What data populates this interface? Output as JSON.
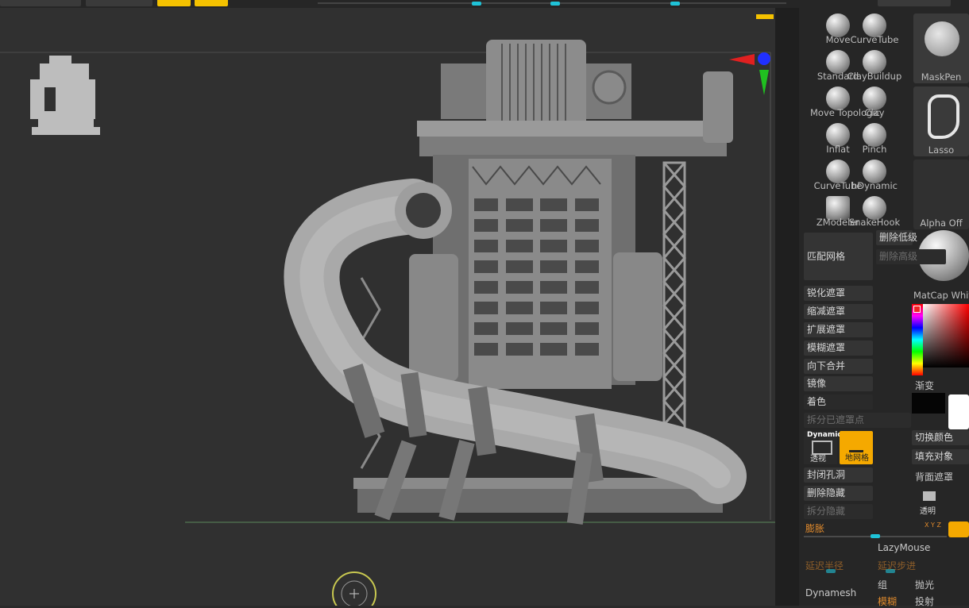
{
  "brushes": [
    {
      "label": "Move"
    },
    {
      "label": "CurveTube"
    },
    {
      "label": "Standard"
    },
    {
      "label": "ClayBuildup"
    },
    {
      "label": "Move Topologic"
    },
    {
      "label": "Clay"
    },
    {
      "label": "Inflat"
    },
    {
      "label": "Pinch"
    },
    {
      "label": "CurveTube"
    },
    {
      "label": "hDynamic"
    },
    {
      "label": "ZModeler"
    },
    {
      "label": "SnakeHook"
    }
  ],
  "thumbs": {
    "maskpen": "MaskPen",
    "lasso": "Lasso",
    "alpha": "Alpha Off",
    "matcap": "MatCap White"
  },
  "tools": {
    "match_mesh": "匹配网格",
    "delete_lower": "删除低级",
    "delete_higher": "删除高级",
    "sharpen_mask": "锐化遮罩",
    "shrink_mask": "缩减遮罩",
    "grow_mask": "扩展遮罩",
    "blur_mask": "模糊遮罩",
    "merge_down": "向下合并",
    "mirror": "镜像",
    "colorize": "着色",
    "split_masked": "拆分已遮罩点",
    "gradient": "渐变",
    "switch_color": "切换颜色",
    "fill_object": "填充对象",
    "backface_mask": "背面遮罩",
    "dynamic_label": "Dynamic",
    "perspective": "透视",
    "floor_grid": "地网格",
    "close_holes": "封闭孔洞",
    "delete_hidden": "删除隐藏",
    "split_hidden": "拆分隐藏",
    "transparent": "透明",
    "inflate": "膨胀",
    "xyz": "X Y Z",
    "lazymouse": "LazyMouse",
    "lazy_radius": "延迟半径",
    "lazy_step": "延迟步进",
    "group": "组",
    "polish": "抛光",
    "dynamesh": "Dynamesh",
    "blur": "模糊",
    "project": "投射"
  },
  "colors": {
    "accent": "#f5c200",
    "slider": "#1fc3d8",
    "orange": "#e08a2c"
  }
}
